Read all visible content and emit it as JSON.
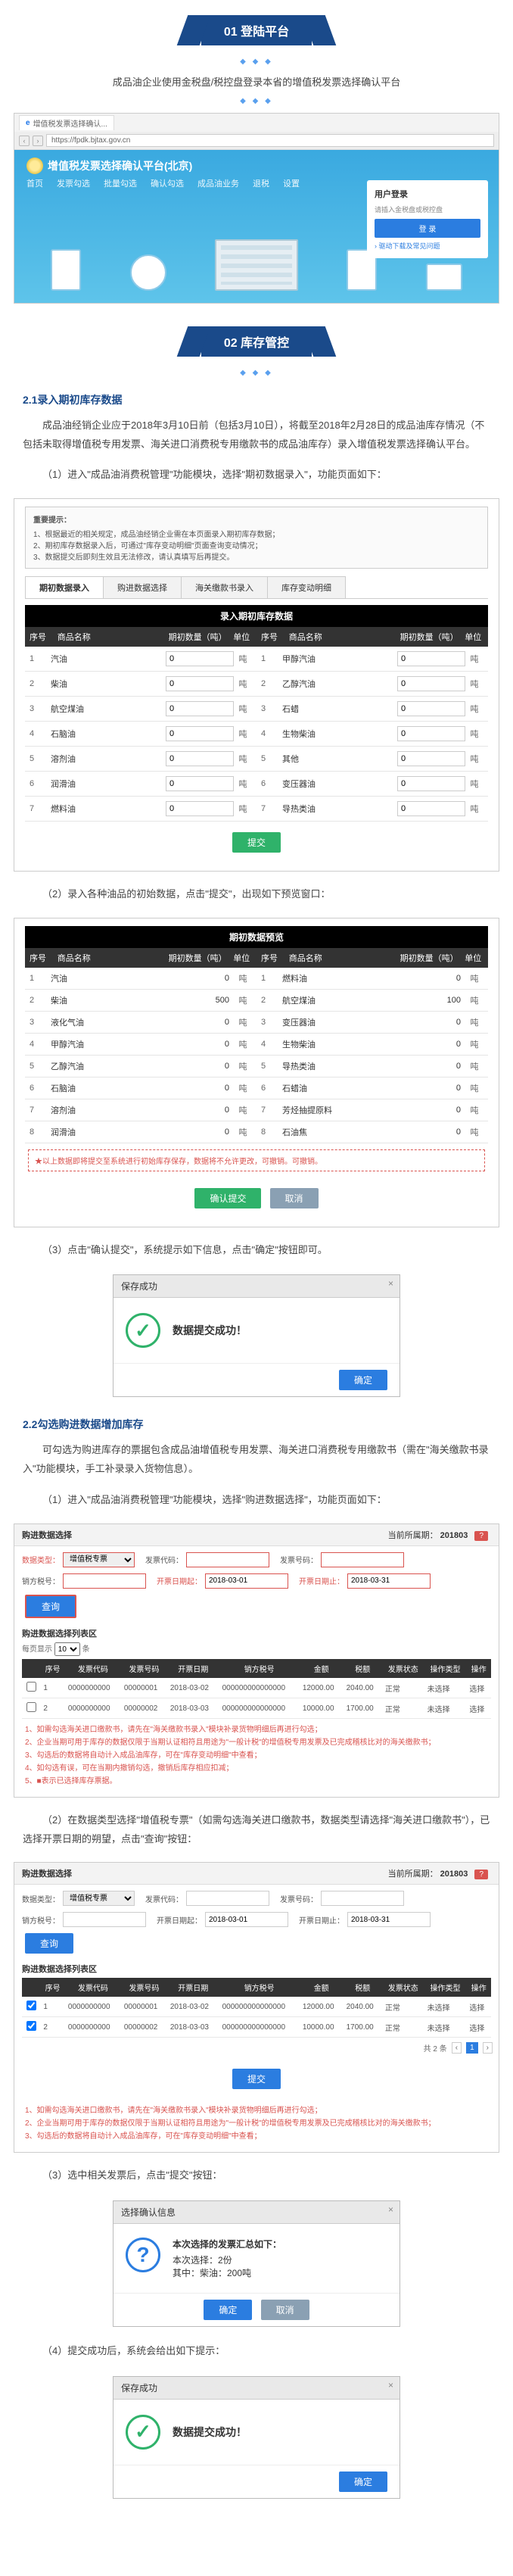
{
  "dots": "◆ ◆ ◆",
  "sec1": {
    "title": "01 登陆平台",
    "desc": "成品油企业使用金税盘/税控盘登录本省的增值税发票选择确认平台"
  },
  "browser": {
    "tab_icon": "e",
    "tab_title": "增值税发票选择确认...",
    "nav_back": "‹",
    "nav_fwd": "›",
    "url": "https://fpdk.bjtax.gov.cn",
    "platform_title": "增值税发票选择确认平台(北京)",
    "menu": [
      "首页",
      "发票勾选",
      "批量勾选",
      "确认勾选",
      "成品油业务",
      "退税",
      "设置"
    ],
    "login": {
      "title": "用户登录",
      "hint": "请插入金税盘或税控盘",
      "btn": "登 录",
      "link": "› 驱动下载及常见问题"
    }
  },
  "sec2": {
    "title": "02 库存管控",
    "sub21": "2.1录入期初库存数据",
    "p1": "成品油经销企业应于2018年3月10日前（包括3月10日），将截至2018年2月28日的成品油库存情况（不包括未取得增值税专用发票、海关进口消费税专用缴款书的成品油库存）录入增值税发票选择确认平台。",
    "p2": "（1）进入\"成品油消费税管理\"功能模块，选择\"期初数据录入\"，功能页面如下：",
    "p3": "（2）录入各种油品的初始数据，点击\"提交\"，出现如下预览窗口：",
    "p4": "（3）点击\"确认提交\"，系统提示如下信息，点击\"确定\"按钮即可。",
    "sub22": "2.2勾选购进数据增加库存",
    "p5": "可勾选为购进库存的票据包含成品油增值税专用发票、海关进口消费税专用缴款书（需在\"海关缴款书录入\"功能模块，手工补录录入货物信息）。",
    "p6": "（1）进入\"成品油消费税管理\"功能模块，选择\"购进数据选择\"，功能页面如下：",
    "p7": "（2）在数据类型选择\"增值税专票\"（如需勾选海关进口缴款书，数据类型请选择\"海关进口缴款书\"），已选择开票日期的朔望，点击\"查询\"按钮：",
    "p8": "（3）选中相关发票后，点击\"提交\"按钮：",
    "p9": "（4）提交成功后，系统会给出如下提示："
  },
  "entryPanel": {
    "hint_title": "重要提示：",
    "hints": [
      "1、根据最近的相关规定，成品油经销企业需在本页面录入期初库存数据；",
      "2、期初库存数据录入后，可通过\"库存变动明细\"页面查询变动情况；",
      "3、数据提交后即刻生效且无法修改，请认真填写后再提交。"
    ],
    "tabs": [
      "期初数据录入",
      "购进数据选择",
      "海关缴款书录入",
      "库存变动明细"
    ],
    "table_title": "录入期初库存数据",
    "hdr": {
      "idx": "序号",
      "name": "商品名称",
      "qty": "期初数量（吨）",
      "unit": "单位"
    },
    "unit": "吨",
    "left": [
      {
        "idx": "1",
        "name": "汽油"
      },
      {
        "idx": "2",
        "name": "柴油"
      },
      {
        "idx": "3",
        "name": "航空煤油"
      },
      {
        "idx": "4",
        "name": "石脑油"
      },
      {
        "idx": "5",
        "name": "溶剂油"
      },
      {
        "idx": "6",
        "name": "润滑油"
      },
      {
        "idx": "7",
        "name": "燃料油"
      }
    ],
    "right": [
      {
        "idx": "1",
        "name": "甲醇汽油"
      },
      {
        "idx": "2",
        "name": "乙醇汽油"
      },
      {
        "idx": "3",
        "name": "石蜡"
      },
      {
        "idx": "4",
        "name": "生物柴油"
      },
      {
        "idx": "5",
        "name": "其他"
      },
      {
        "idx": "6",
        "name": "变压器油"
      },
      {
        "idx": "7",
        "name": "导热类油"
      }
    ],
    "val0": "0",
    "submit": "提交"
  },
  "preview": {
    "title": "期初数据预览",
    "hdr": {
      "idx": "序号",
      "name": "商品名称",
      "qty": "期初数量（吨）",
      "unit": "单位"
    },
    "unit": "吨",
    "left": [
      {
        "idx": "1",
        "name": "汽油",
        "val": "0"
      },
      {
        "idx": "2",
        "name": "柴油",
        "val": "500"
      },
      {
        "idx": "3",
        "name": "液化气油",
        "val": "0"
      },
      {
        "idx": "4",
        "name": "甲醇汽油",
        "val": "0"
      },
      {
        "idx": "5",
        "name": "乙醇汽油",
        "val": "0"
      },
      {
        "idx": "6",
        "name": "石脑油",
        "val": "0"
      },
      {
        "idx": "7",
        "name": "溶剂油",
        "val": "0"
      },
      {
        "idx": "8",
        "name": "润滑油",
        "val": "0"
      }
    ],
    "right": [
      {
        "idx": "1",
        "name": "燃料油",
        "val": "0"
      },
      {
        "idx": "2",
        "name": "航空煤油",
        "val": "100"
      },
      {
        "idx": "3",
        "name": "变压器油",
        "val": "0"
      },
      {
        "idx": "4",
        "name": "生物柴油",
        "val": "0"
      },
      {
        "idx": "5",
        "name": "导热类油",
        "val": "0"
      },
      {
        "idx": "6",
        "name": "石蜡油",
        "val": "0"
      },
      {
        "idx": "7",
        "name": "芳烃抽提原料",
        "val": "0"
      },
      {
        "idx": "8",
        "name": "石油焦",
        "val": "0"
      }
    ],
    "warn": "★以上数据即将提交至系统进行初始库存保存，数据将不允许更改，可撤销。可撤销。",
    "btn_confirm": "确认提交",
    "btn_cancel": "取消"
  },
  "modal_ok": {
    "title": "保存成功",
    "msg": "数据提交成功！",
    "btn": "确定",
    "close": "×"
  },
  "purchase": {
    "bar_left": "购进数据选择",
    "bar_right_label": "当前所属期：",
    "bar_right_val": "201803",
    "help_ico": "?",
    "labels": {
      "type": "数据类型：",
      "code": "发票代码：",
      "no": "发票号码：",
      "seller": "销方税号：",
      "date_from": "开票日期起：",
      "date_to": "开票日期止："
    },
    "type_opts": [
      "增值税专票",
      "海关进口缴款书"
    ],
    "date_from": "2018-03-01",
    "date_to": "2018-03-31",
    "btn_query": "查询",
    "list_title": "购进数据选择列表区",
    "pager_lab": "每页显示",
    "pager_opt": "10",
    "pager_unit": "条",
    "tbl_hdr": [
      "",
      "序号",
      "发票代码",
      "发票号码",
      "开票日期",
      "销方税号",
      "金额",
      "税额",
      "发票状态",
      "操作类型",
      "操作"
    ],
    "rows": [
      [
        "1",
        "0000000000",
        "00000001",
        "2018-03-02",
        "000000000000000",
        "12000.00",
        "2040.00",
        "正常",
        "未选择",
        "选择"
      ],
      [
        "2",
        "0000000000",
        "00000002",
        "2018-03-03",
        "000000000000000",
        "10000.00",
        "1700.00",
        "正常",
        "未选择",
        "选择"
      ]
    ],
    "notes": [
      "1、如需勾选海关进口缴款书，请先在\"海关缴款书录入\"模块补录货物明细后再进行勾选；",
      "2、企业当期可用于库存的数据仅限于当期认证相符且用途为\"一般计税\"的增值税专用发票及已完成稽核比对的海关缴款书；",
      "3、勾选后的数据将自动计入成品油库存，可在\"库存变动明细\"中查看；",
      "4、如勾选有误，可在当期内撤销勾选，撤销后库存相应扣减；",
      "5、■表示已选择库存票据。"
    ],
    "pager_total": "共 2 条",
    "pg_prev": "‹",
    "pg_next": "›",
    "submit": "提交"
  },
  "confirm_modal": {
    "title": "选择确认信息",
    "head": "本次选择的发票汇总如下：",
    "line1": "本次选择：2份",
    "line2": "其中：柴油：200吨",
    "btn_ok": "确定",
    "btn_cancel": "取消"
  }
}
